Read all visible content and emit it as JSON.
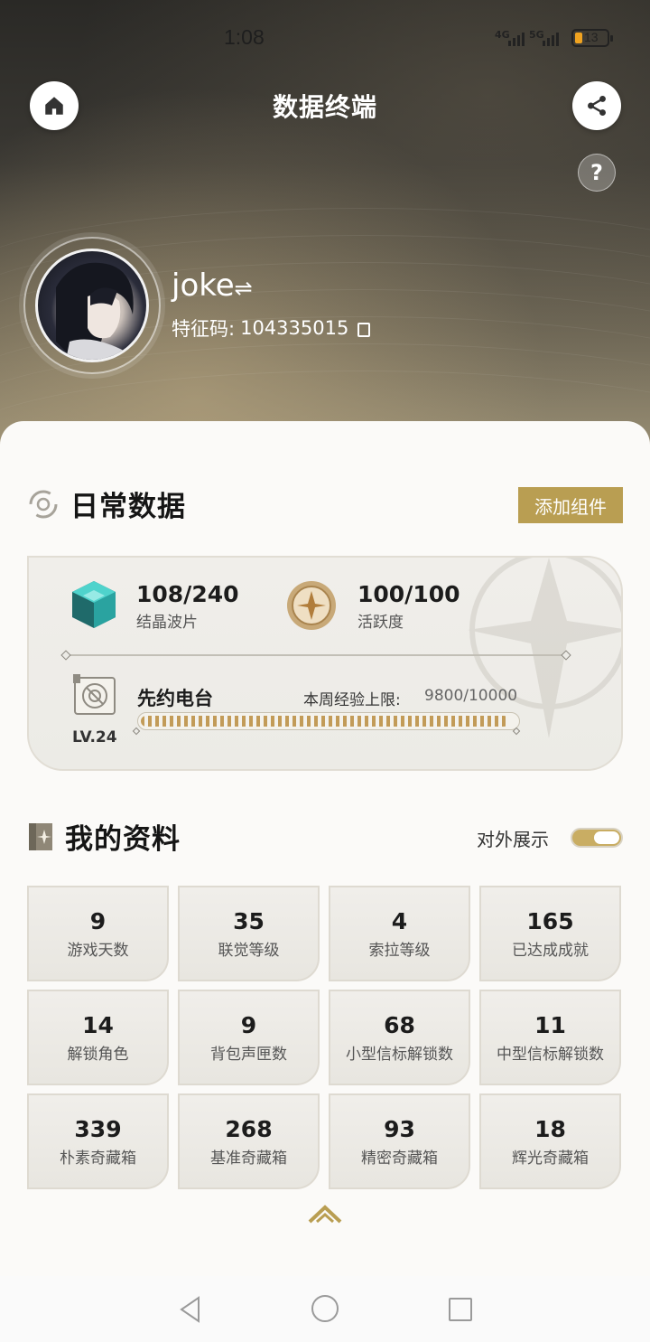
{
  "status_bar": {
    "time": "1:08",
    "network_1": "4G",
    "network_2": "5G",
    "battery": "13"
  },
  "header": {
    "title": "数据终端",
    "help_glyph": "?",
    "home_icon": "home-icon",
    "share_icon": "share-icon"
  },
  "profile": {
    "name": "joke",
    "name_suffix": "⇌",
    "id_label": "特征码:",
    "id_value": "104335015"
  },
  "daily": {
    "title": "日常数据",
    "add_button": "添加组件",
    "crystal": {
      "value": "108/240",
      "label": "结晶波片"
    },
    "activity": {
      "value": "100/100",
      "label": "活跃度"
    },
    "radio": {
      "name": "先约电台",
      "level": "LV.24",
      "exp_label": "本周经验上限:",
      "exp_value": "9800/10000",
      "exp_fraction": 0.98
    }
  },
  "my_profile": {
    "title": "我的资料",
    "toggle_label": "对外展示",
    "toggle_on": true,
    "stats": [
      {
        "value": "9",
        "label": "游戏天数"
      },
      {
        "value": "35",
        "label": "联觉等级"
      },
      {
        "value": "4",
        "label": "索拉等级"
      },
      {
        "value": "165",
        "label": "已达成成就"
      },
      {
        "value": "14",
        "label": "解锁角色"
      },
      {
        "value": "9",
        "label": "背包声匣数"
      },
      {
        "value": "68",
        "label": "小型信标解锁数"
      },
      {
        "value": "11",
        "label": "中型信标解锁数"
      },
      {
        "value": "339",
        "label": "朴素奇藏箱"
      },
      {
        "value": "268",
        "label": "基准奇藏箱"
      },
      {
        "value": "93",
        "label": "精密奇藏箱"
      },
      {
        "value": "18",
        "label": "辉光奇藏箱"
      }
    ]
  },
  "colors": {
    "accent_gold": "#b99e52",
    "panel_bg": "#ecebe6",
    "battery_orange": "#f0a320"
  }
}
